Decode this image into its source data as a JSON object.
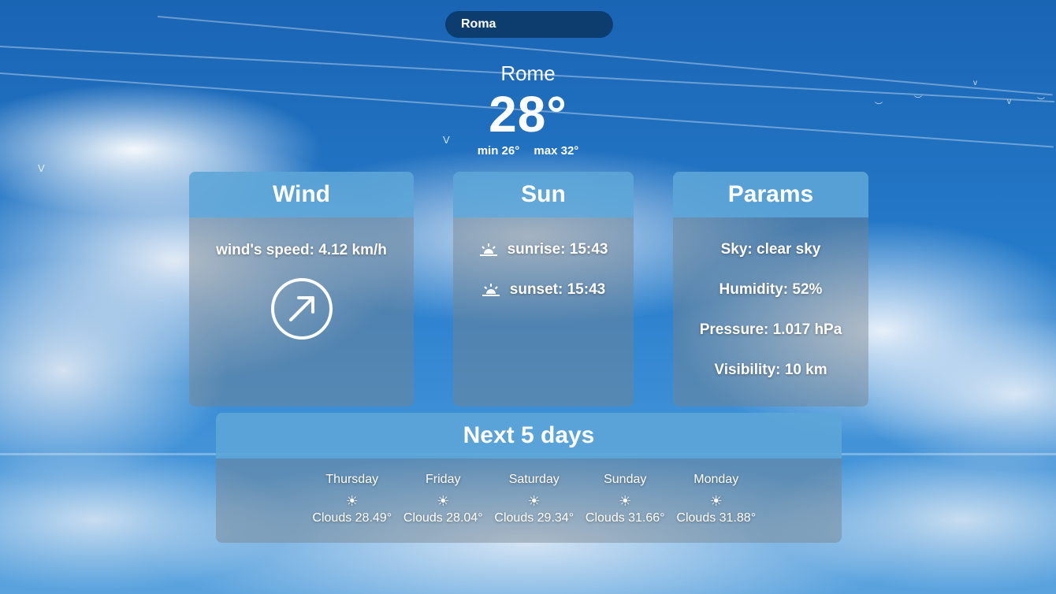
{
  "search": {
    "value": "Roma"
  },
  "current": {
    "city": "Rome",
    "temp": "28°",
    "min": "min 26°",
    "max": "max 32°"
  },
  "wind": {
    "title": "Wind",
    "speed": "wind's speed: 4.12 km/h",
    "direction_icon": "arrow-up-right-icon"
  },
  "sun": {
    "title": "Sun",
    "sunrise": "sunrise: 15:43",
    "sunset": "sunset: 15:43"
  },
  "params": {
    "title": "Params",
    "sky": "Sky: clear sky",
    "humidity": "Humidity: 52%",
    "pressure": "Pressure: 1.017 hPa",
    "visibility": "Visibility: 10 km"
  },
  "forecast": {
    "title": "Next 5 days",
    "days": [
      {
        "name": "Thursday",
        "icon": "☀",
        "temp": "Clouds 28.49°"
      },
      {
        "name": "Friday",
        "icon": "☀",
        "temp": "Clouds 28.04°"
      },
      {
        "name": "Saturday",
        "icon": "☀",
        "temp": "Clouds 29.34°"
      },
      {
        "name": "Sunday",
        "icon": "☀",
        "temp": "Clouds 31.66°"
      },
      {
        "name": "Monday",
        "icon": "☀",
        "temp": "Clouds 31.88°"
      }
    ]
  },
  "colors": {
    "search_bg": "#0d3d6e",
    "card_header": "#5aaae1",
    "sky_top": "#1a64b4"
  }
}
